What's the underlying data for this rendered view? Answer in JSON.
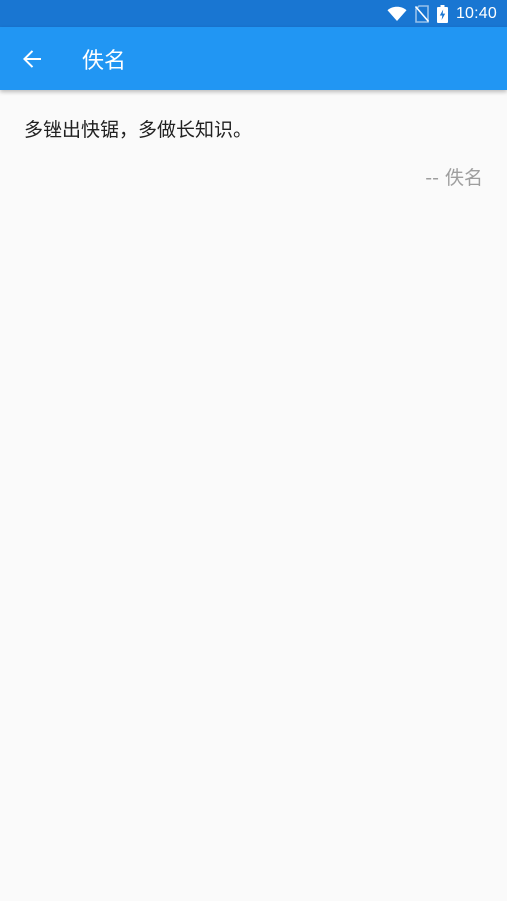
{
  "status_bar": {
    "time": "10:40",
    "icons": [
      "wifi-icon",
      "no-sim-icon",
      "battery-charging-icon"
    ]
  },
  "app_bar": {
    "back_icon": "arrow-back-icon",
    "title": "佚名"
  },
  "quote": {
    "text": "多锉出快锯，多做长知识。",
    "author": "-- 佚名"
  },
  "colors": {
    "status_bar": "#1976d2",
    "app_bar": "#2196f3",
    "background": "#fafafa",
    "text_primary": "#212121",
    "text_secondary": "#9e9e9e"
  }
}
